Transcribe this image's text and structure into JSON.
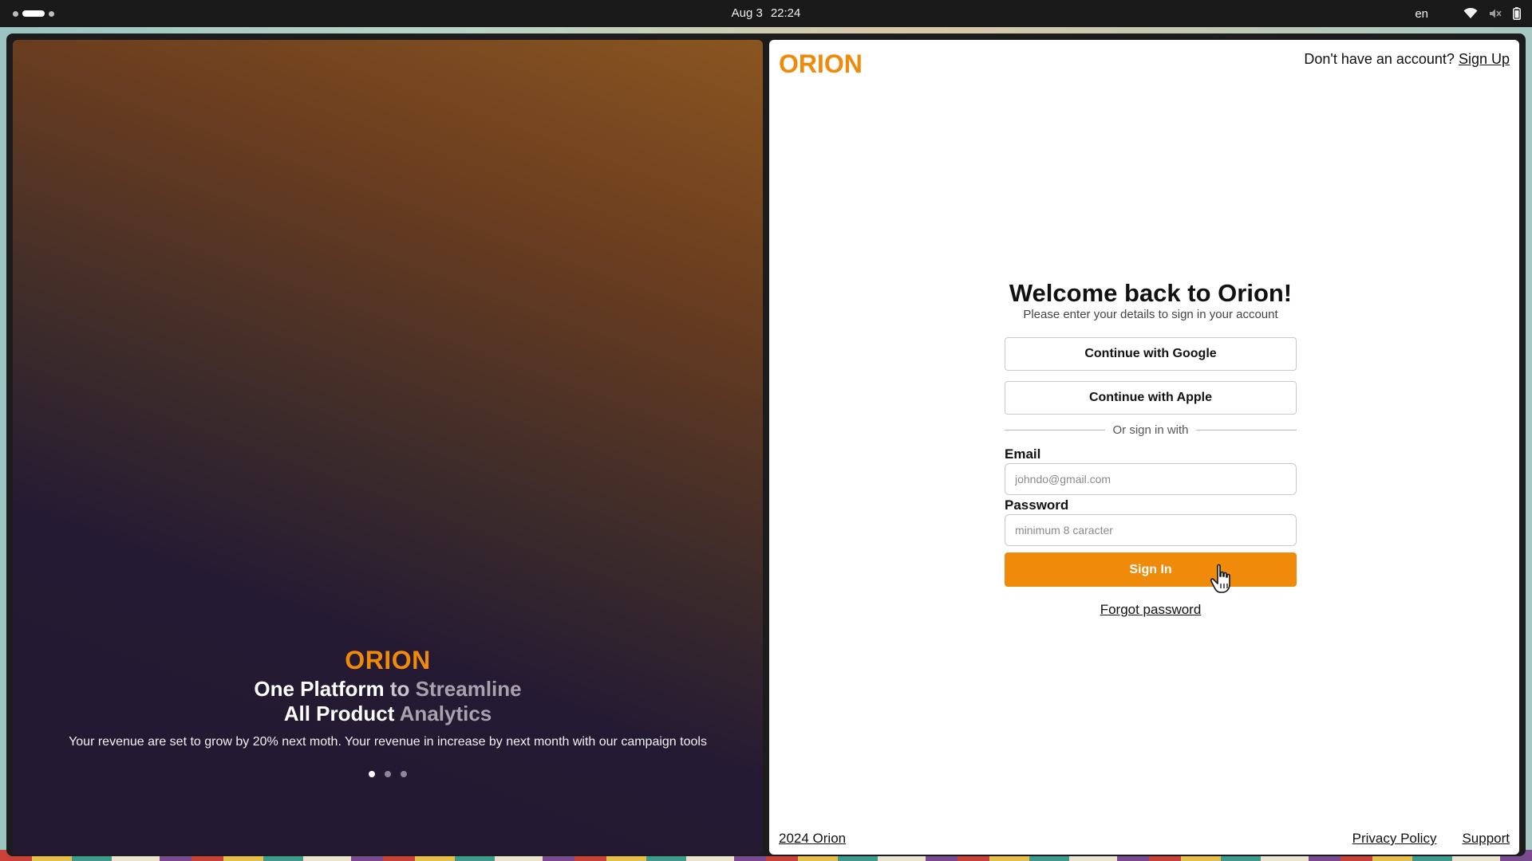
{
  "system_bar": {
    "date": "Aug 3",
    "time": "22:24",
    "language": "en",
    "icons": [
      "wifi-icon",
      "volume-muted-icon",
      "battery-icon"
    ]
  },
  "hero": {
    "brand": "ORION",
    "title_line1_part1": "One Platform",
    "title_line1_part2": "to",
    "title_line1_part3": "Streamline",
    "title_line2_part1": "All Product",
    "title_line2_part2": "Analytics",
    "description": "Your revenue are set to grow by 20% next moth. Your revenue in increase by next month with our campaign tools",
    "carousel": {
      "count": 3,
      "active_index": 1
    }
  },
  "header": {
    "logo": "ORION",
    "signup_prompt": "Don't have an account?",
    "signup_link": "Sign Up"
  },
  "form": {
    "title": "Welcome back to Orion!",
    "subtitle": "Please enter your details to sign in your account",
    "google_button": "Continue with Google",
    "apple_button": "Continue with Apple",
    "divider_text": "Or sign in with",
    "email_label": "Email",
    "email_placeholder": "johndo@gmail.com",
    "email_value": "",
    "password_label": "Password",
    "password_placeholder": "minimum 8 caracter",
    "password_value": "",
    "signin_button": "Sign In",
    "forgot_link": "Forgot password"
  },
  "footer": {
    "copyright": "2024 Orion",
    "privacy_link": "Privacy Policy",
    "support_link": "Support"
  },
  "colors": {
    "accent": "#f08a0b",
    "topbar": "#1a1a1a",
    "hero_top": "#8a5520",
    "hero_bottom": "#221831"
  }
}
